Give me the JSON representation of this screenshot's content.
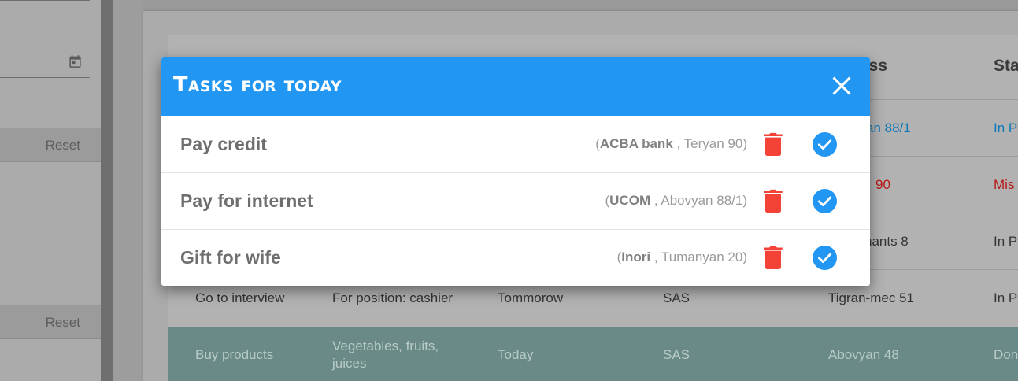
{
  "left_panel": {
    "reset_buttons": [
      {
        "label": "Reset"
      },
      {
        "label": "Reset"
      }
    ],
    "icons": {
      "date": "calendar-icon"
    }
  },
  "table": {
    "partial_headers": [
      "ess",
      "Sta"
    ],
    "rows": [
      {
        "address": "an 88/1",
        "status": "In P",
        "address_color": "#0f78b8",
        "status_color": "#0f78b8"
      },
      {
        "address": "90",
        "status": "Mis",
        "address_color": "#b81818",
        "status_color": "#b81818"
      },
      {
        "address": "nants 8",
        "status": "In P"
      },
      {
        "title": "Go to interview",
        "description": "For position: cashier",
        "date": "Tommorow",
        "company": "SAS",
        "address": "Tigran-mec 51",
        "status": "In P"
      },
      {
        "title": "Buy products",
        "description_line1": "Vegetables, fruits,",
        "description_line2": "juices",
        "date": "Today",
        "company": "SAS",
        "address": "Abovyan 48",
        "status": "Don",
        "highlight_color": "#698a86"
      }
    ]
  },
  "modal": {
    "title": "Tasks for today",
    "header_color": "#2196f3",
    "icons": {
      "close": "close-icon",
      "delete": "trash-icon",
      "complete": "check-circle-icon"
    },
    "tasks": [
      {
        "name": "Pay credit",
        "open_paren": "(",
        "company": "ACBA bank",
        "separator": " , ",
        "address": "Teryan 90",
        "close_paren": ")"
      },
      {
        "name": "Pay for internet",
        "open_paren": "(",
        "company": "UCOM",
        "separator": " , ",
        "address": "Abovyan 88/1",
        "close_paren": ")"
      },
      {
        "name": "Gift for wife",
        "open_paren": "(",
        "company": "Inori",
        "separator": " , ",
        "address": "Tumanyan 20",
        "close_paren": ")"
      }
    ],
    "delete_color": "#f44336",
    "complete_color": "#2196f3"
  }
}
